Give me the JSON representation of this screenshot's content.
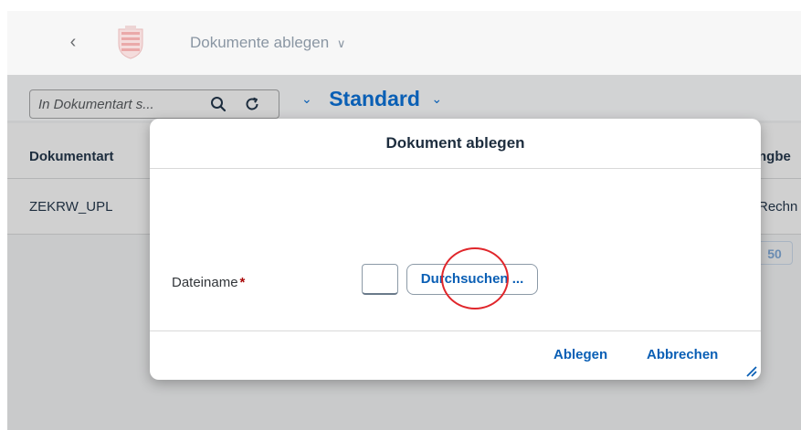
{
  "shell": {
    "back_icon": "chevron-left-icon",
    "title": "Dokumente ablegen",
    "title_chevron": "∨"
  },
  "toolbar": {
    "search_placeholder": "In Dokumentart s...",
    "search_icon": "search-icon",
    "refresh_icon": "refresh-icon",
    "variant_label": "Standard"
  },
  "table": {
    "columns": [
      "Dokumentart",
      "ngbe"
    ],
    "rows": [
      {
        "doc_type": "ZEKRW_UPL",
        "right": "Rechn"
      }
    ],
    "growing_threshold": "50"
  },
  "dialog": {
    "title": "Dokument ablegen",
    "file_label": "Dateiname",
    "required_marker": "*",
    "browse_label": "Durchsuchen ...",
    "ablegen_label": "Ablegen",
    "abbrechen_label": "Abbrechen"
  },
  "colors": {
    "accent": "#0a5fb5",
    "annotation": "#e0262b",
    "required": "#aa0808"
  }
}
